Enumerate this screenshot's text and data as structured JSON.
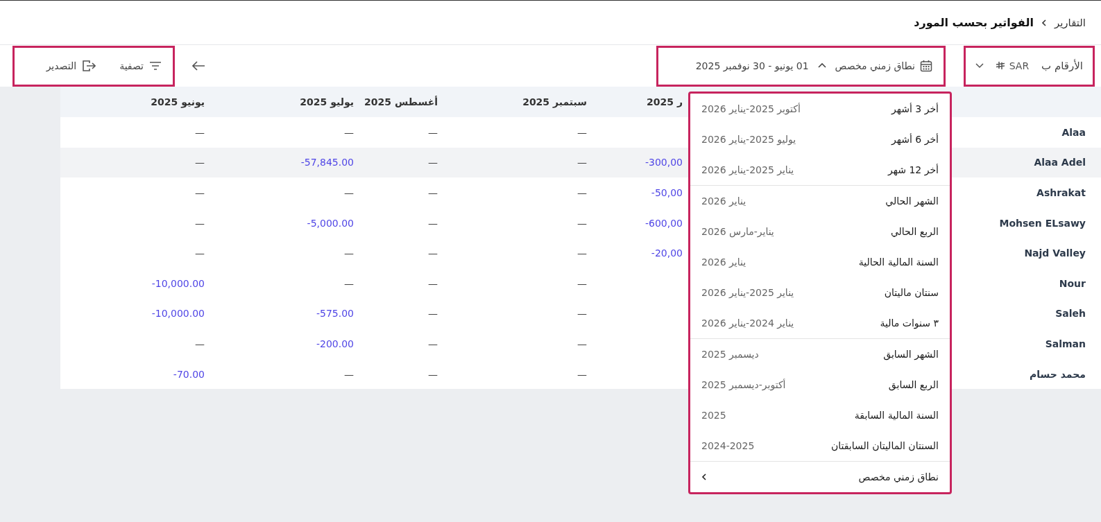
{
  "breadcrumb": {
    "parent": "التقارير",
    "current": "الفواتير بحسب المورد"
  },
  "toolbar": {
    "figures_in": {
      "label": "الأرقام ب",
      "currency": "SAR"
    },
    "date_range": {
      "label": "نطاق زمني مخصص",
      "value": "01 يونيو - 30 نوفمبر 2025",
      "expanded": true
    },
    "filter": "تصفية",
    "export": "التصدير"
  },
  "table": {
    "columns": [
      {
        "label": "ر 2025"
      },
      {
        "label": "سبتمبر 2025"
      },
      {
        "label": "أغسطس 2025"
      },
      {
        "label": "يوليو 2025"
      },
      {
        "label": "يونيو 2025"
      }
    ],
    "rows": [
      {
        "name": "Alaa",
        "highlighted": false,
        "cells": [
          null,
          {
            "text": "—",
            "kind": "empty"
          },
          {
            "text": "—",
            "kind": "empty"
          },
          {
            "text": "—",
            "kind": "empty"
          },
          {
            "text": "—",
            "kind": "empty"
          }
        ]
      },
      {
        "name": "Alaa Adel",
        "highlighted": true,
        "cells": [
          {
            "text": "-300,00",
            "kind": "amount"
          },
          {
            "text": "—",
            "kind": "empty"
          },
          {
            "text": "—",
            "kind": "empty"
          },
          {
            "text": "-57,845.00",
            "kind": "amount"
          },
          {
            "text": "—",
            "kind": "empty"
          }
        ]
      },
      {
        "name": "Ashrakat",
        "highlighted": false,
        "cells": [
          {
            "text": "-50,00",
            "kind": "amount"
          },
          {
            "text": "—",
            "kind": "empty"
          },
          {
            "text": "—",
            "kind": "empty"
          },
          {
            "text": "—",
            "kind": "empty"
          },
          {
            "text": "—",
            "kind": "empty"
          }
        ]
      },
      {
        "name": "Mohsen ELsawy",
        "highlighted": false,
        "cells": [
          {
            "text": "-600,00",
            "kind": "amount"
          },
          {
            "text": "—",
            "kind": "empty"
          },
          {
            "text": "—",
            "kind": "empty"
          },
          {
            "text": "-5,000.00",
            "kind": "amount"
          },
          {
            "text": "—",
            "kind": "empty"
          }
        ]
      },
      {
        "name": "Najd Valley",
        "highlighted": false,
        "cells": [
          {
            "text": "-20,00",
            "kind": "amount"
          },
          {
            "text": "—",
            "kind": "empty"
          },
          {
            "text": "—",
            "kind": "empty"
          },
          {
            "text": "—",
            "kind": "empty"
          },
          {
            "text": "—",
            "kind": "empty"
          }
        ]
      },
      {
        "name": "Nour",
        "highlighted": false,
        "cells": [
          null,
          {
            "text": "—",
            "kind": "empty"
          },
          {
            "text": "—",
            "kind": "empty"
          },
          {
            "text": "—",
            "kind": "empty"
          },
          {
            "text": "-10,000.00",
            "kind": "amount"
          }
        ]
      },
      {
        "name": "Saleh",
        "highlighted": false,
        "cells": [
          null,
          {
            "text": "—",
            "kind": "empty"
          },
          {
            "text": "—",
            "kind": "empty"
          },
          {
            "text": "-575.00",
            "kind": "amount"
          },
          {
            "text": "-10,000.00",
            "kind": "amount"
          }
        ]
      },
      {
        "name": "Salman",
        "highlighted": false,
        "cells": [
          null,
          {
            "text": "—",
            "kind": "empty"
          },
          {
            "text": "—",
            "kind": "empty"
          },
          {
            "text": "-200.00",
            "kind": "amount"
          },
          {
            "text": "—",
            "kind": "empty"
          }
        ]
      },
      {
        "name": "محمد حسام",
        "highlighted": false,
        "cells": [
          null,
          {
            "text": "—",
            "kind": "empty"
          },
          {
            "text": "—",
            "kind": "empty"
          },
          {
            "text": "—",
            "kind": "empty"
          },
          {
            "text": "-70.00",
            "kind": "amount"
          }
        ]
      }
    ]
  },
  "date_menu": {
    "groups": [
      [
        {
          "label": "أخر 3 أشهر",
          "range": "أكتوبر 2025-يناير 2026"
        },
        {
          "label": "أخر 6 أشهر",
          "range": "يوليو 2025-يناير 2026"
        },
        {
          "label": "أخر 12 شهر",
          "range": "يناير 2025-يناير 2026"
        }
      ],
      [
        {
          "label": "الشهر الحالي",
          "range": "يناير 2026"
        },
        {
          "label": "الربع الحالي",
          "range": "يناير-مارس 2026"
        },
        {
          "label": "السنة المالية الحالية",
          "range": "يناير 2026"
        },
        {
          "label": "سنتان ماليتان",
          "range": "يناير 2025-يناير 2026"
        },
        {
          "label": "٣ سنوات مالية",
          "range": "يناير 2024-يناير 2026"
        }
      ],
      [
        {
          "label": "الشهر السابق",
          "range": "ديسمبر 2025"
        },
        {
          "label": "الربع السابق",
          "range": "أكتوبر-ديسمبر 2025"
        },
        {
          "label": "السنة المالية السابقة",
          "range": "2025"
        },
        {
          "label": "السنتان الماليتان السابقتان",
          "range": "2024-2025"
        }
      ]
    ],
    "custom": "نطاق زمني مخصص"
  }
}
